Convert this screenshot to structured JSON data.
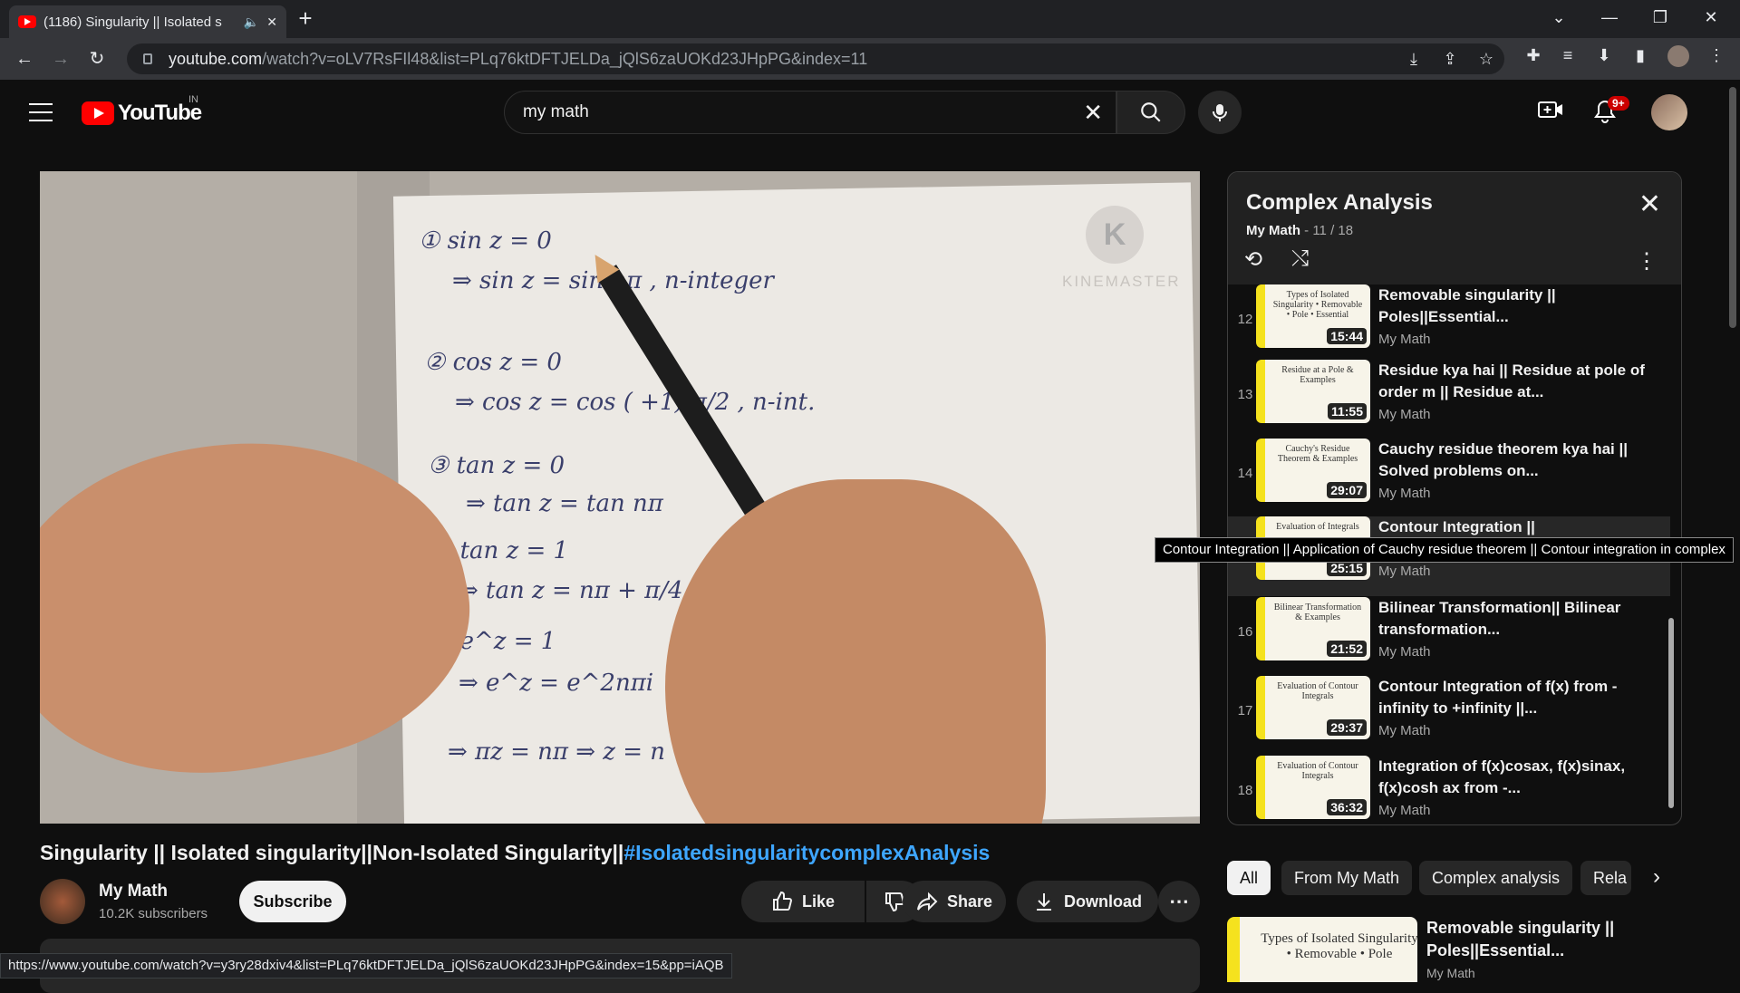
{
  "browser": {
    "tab_title": "(1186) Singularity || Isolated s",
    "url_host": "youtube.com",
    "url_rest": "/watch?v=oLV7RsFIl48&list=PLq76ktDFTJELDa_jQlS6zaUOKd23JHpPG&index=11",
    "status_url": "https://www.youtube.com/watch?v=y3ry28dxiv4&list=PLq76ktDFTJELDa_jQlS6zaUOKd23JHpPG&index=15&pp=iAQB"
  },
  "header": {
    "logo": "YouTube",
    "country": "IN",
    "search_value": "my math",
    "notif_count": "9+"
  },
  "video": {
    "watermark": "KINEMASTER",
    "watermark_logo": "K",
    "title_main": "Singularity || Isolated singularity||Non-Isolated Singularity||",
    "title_tag": "#IsolatedsingularitycomplexAnalysis",
    "channel_name": "My Math",
    "channel_subs": "10.2K subscribers",
    "subscribe": "Subscribe",
    "like": "Like",
    "share": "Share",
    "download": "Download",
    "math_lines": [
      "① sin z = 0",
      "⇒ sin z = sin nπ ,  n-integer",
      "② cos z = 0",
      "⇒ cos z = cos (   +1) π/2    , n-int.",
      "③ tan z = 0",
      "⇒ tan z = tan nπ",
      "④ tan z = 1",
      "⇒ tan z = nπ + π/4",
      "⑤ e^z = 1",
      "⇒ e^z = e^2nπi",
      "⇒ πz = nπ ⇒ z = n"
    ]
  },
  "playlist": {
    "title": "Complex Analysis",
    "channel": "My Math",
    "position": " - 11 / 18",
    "items": [
      {
        "index": "12",
        "title": "Removable singularity || Poles||Essential...",
        "channel": "My Math",
        "duration": "15:44",
        "thumb": "Types of Isolated Singularity • Removable • Pole • Essential"
      },
      {
        "index": "13",
        "title": "Residue kya hai || Residue at pole of order m || Residue at...",
        "channel": "My Math",
        "duration": "11:55",
        "thumb": "Residue at a Pole & Examples"
      },
      {
        "index": "14",
        "title": "Cauchy residue theorem kya hai || Solved problems on...",
        "channel": "My Math",
        "duration": "29:07",
        "thumb": "Cauchy's Residue Theorem & Examples"
      },
      {
        "index": "15",
        "title": "Contour Integration ||",
        "channel": "My Math",
        "duration": "25:15",
        "thumb": "Evaluation of Integrals"
      },
      {
        "index": "16",
        "title": "Bilinear Transformation|| Bilinear transformation...",
        "channel": "My Math",
        "duration": "21:52",
        "thumb": "Bilinear Transformation & Examples"
      },
      {
        "index": "17",
        "title": "Contour Integration of f(x) from -infinity to +infinity ||...",
        "channel": "My Math",
        "duration": "29:37",
        "thumb": "Evaluation of Contour Integrals"
      },
      {
        "index": "18",
        "title": "Integration of f(x)cosax, f(x)sinax, f(x)cosh ax from -...",
        "channel": "My Math",
        "duration": "36:32",
        "thumb": "Evaluation of Contour Integrals"
      }
    ],
    "tooltip": "Contour Integration || Application of Cauchy residue theorem || Contour integration in complex"
  },
  "chips": [
    "All",
    "From My Math",
    "Complex analysis",
    "Rela"
  ],
  "recommended": {
    "thumb": "Types of Isolated Singularity • Removable • Pole",
    "title": "Removable singularity || Poles||Essential...",
    "channel": "My Math"
  },
  "colors": {
    "accent": "#ff0000",
    "link": "#3ea6ff",
    "thumb_yellow": "#f5e21e"
  }
}
